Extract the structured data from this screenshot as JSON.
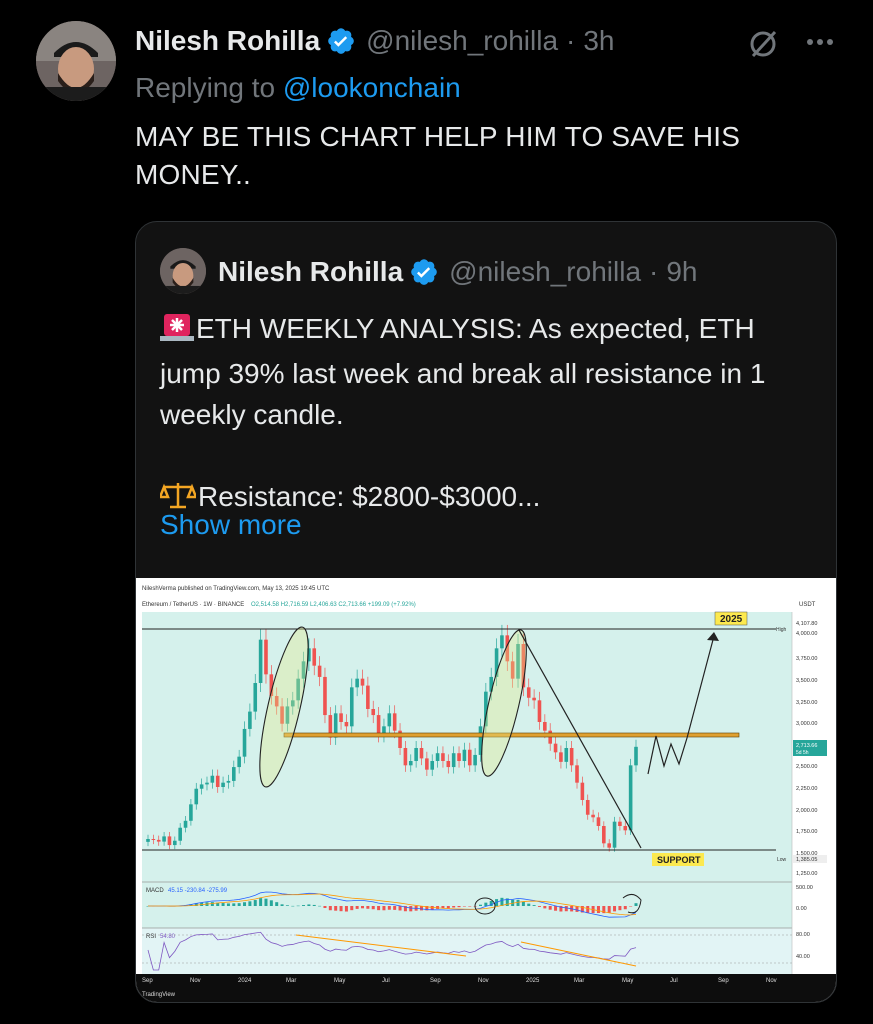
{
  "post": {
    "author_name": "Nilesh Rohilla",
    "handle": "@nilesh_rohilla",
    "separator": "·",
    "time": "3h",
    "replying_prefix": "Replying to",
    "replying_to": "@lookonchain",
    "text": "MAY BE THIS CHART HELP HIM TO SAVE HIS MONEY.."
  },
  "quote": {
    "author_name": "Nilesh Rohilla",
    "handle": "@nilesh_rohilla",
    "separator": "·",
    "time": "9h",
    "line1": "ETH WEEKLY ANALYSIS:  As expected, ETH jump 39% last week and break all resistance in 1 weekly candle.",
    "line2": "Resistance: $2800-$3000...",
    "show_more": "Show more"
  },
  "chart": {
    "published": "NileshVerma published on TradingView.com, May 13, 2025 19:45 UTC",
    "symbol": "Ethereum / TetherUS · 1W · BINANCE",
    "ohlc": "O2,514.58 H2,716.59 L2,406.63 C2,713.66 +199.09 (+7.92%)",
    "currency": "USDT",
    "label_2025": "2025",
    "label_support": "SUPPORT",
    "label_high": "High",
    "label_low": "Low",
    "current_price": "2,713.66",
    "countdown": "5d 5h",
    "high_price": "4,107.80",
    "low_price": "1,385.05",
    "price_ticks": [
      "4,000.00",
      "3,750.00",
      "3,500.00",
      "3,250.00",
      "3,000.00",
      "2,500.00",
      "2,250.00",
      "2,000.00",
      "1,750.00",
      "1,500.00",
      "1,250.00"
    ],
    "macd_label": "MACD",
    "macd_values": "45.15  -230.84  -275.99",
    "macd_ticks": [
      "500.00",
      "0.00"
    ],
    "rsi_label": "RSI",
    "rsi_values": "54.80",
    "rsi_ticks": [
      "80.00",
      "40.00"
    ],
    "x_ticks": [
      "Sep",
      "Nov",
      "2024",
      "Mar",
      "May",
      "Jul",
      "Sep",
      "Nov",
      "2025",
      "Mar",
      "May",
      "Jul",
      "Sep",
      "Nov"
    ],
    "footer": "TradingView"
  },
  "chart_data": {
    "type": "candlestick",
    "title": "Ethereum / TetherUS · 1W · BINANCE",
    "ylabel": "USDT",
    "ylim": [
      1200,
      4200
    ],
    "resistance_zone": [
      2800,
      3000
    ],
    "support_level": 1385.05,
    "top_level": 4107.8,
    "last_close": 2713.66,
    "closes": [
      1650,
      1640,
      1620,
      1680,
      1580,
      1630,
      1780,
      1860,
      2050,
      2230,
      2280,
      2300,
      2380,
      2250,
      2300,
      2320,
      2480,
      2600,
      2920,
      3120,
      3450,
      3950,
      3550,
      3300,
      3180,
      2980,
      3180,
      3250,
      3500,
      3700,
      3850,
      3650,
      3520,
      3080,
      2820,
      3100,
      3000,
      2950,
      3400,
      3500,
      3420,
      3150,
      3080,
      2850,
      2950,
      3100,
      2900,
      2700,
      2500,
      2550,
      2700,
      2580,
      2450,
      2550,
      2640,
      2550,
      2480,
      2640,
      2550,
      2680,
      2500,
      2620,
      2950,
      3350,
      3520,
      3850,
      4000,
      3700,
      3500,
      3900,
      3400,
      3280,
      3250,
      3000,
      2900,
      2750,
      2650,
      2540,
      2700,
      2500,
      2300,
      2100,
      1930,
      1900,
      1800,
      1600,
      1550,
      1850,
      1800,
      1750,
      2500,
      2713.66
    ]
  }
}
